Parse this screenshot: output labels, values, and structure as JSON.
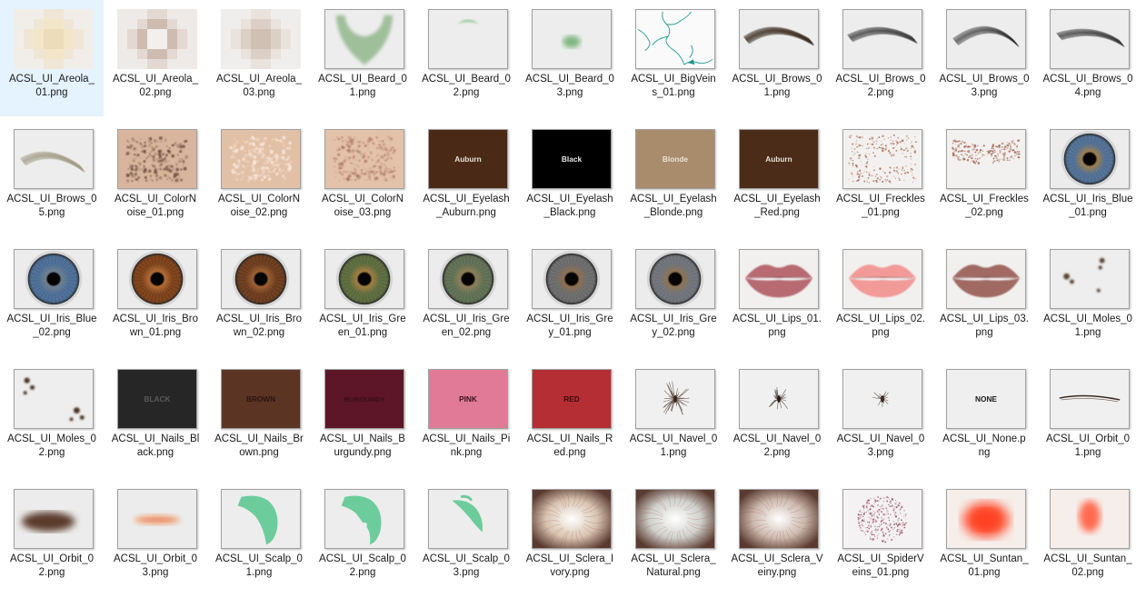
{
  "items": [
    {
      "name_lines": [
        "ACSL_UI_Areola_",
        "01.png"
      ],
      "icon": "pixelated-light-areola",
      "frame": false
    },
    {
      "name_lines": [
        "ACSL_UI_Areola_",
        "02.png"
      ],
      "icon": "pixelated-medium-areola",
      "frame": false
    },
    {
      "name_lines": [
        "ACSL_UI_Areola_",
        "03.png"
      ],
      "icon": "pixelated-faint-areola",
      "frame": false
    },
    {
      "name_lines": [
        "ACSL_UI_Beard_0",
        "1.png"
      ],
      "icon": "full-beard-mask"
    },
    {
      "name_lines": [
        "ACSL_UI_Beard_0",
        "2.png"
      ],
      "icon": "mustache-mask"
    },
    {
      "name_lines": [
        "ACSL_UI_Beard_0",
        "3.png"
      ],
      "icon": "goatee-mask"
    },
    {
      "name_lines": [
        "ACSL_UI_BigVein",
        "s_01.png"
      ],
      "icon": "vein-lines"
    },
    {
      "name_lines": [
        "ACSL_UI_Brows_0",
        "1.png"
      ],
      "icon": "eyebrow-thick"
    },
    {
      "name_lines": [
        "ACSL_UI_Brows_0",
        "2.png"
      ],
      "icon": "eyebrow-arched"
    },
    {
      "name_lines": [
        "ACSL_UI_Brows_0",
        "3.png"
      ],
      "icon": "eyebrow-high-arch"
    },
    {
      "name_lines": [
        "ACSL_UI_Brows_0",
        "4.png"
      ],
      "icon": "eyebrow-angled"
    },
    {
      "name_lines": [
        "ACSL_UI_Brows_0",
        "5.png"
      ],
      "icon": "eyebrow-light"
    },
    {
      "name_lines": [
        "ACSL_UI_ColorN",
        "oise_01.png"
      ],
      "icon": "skin-noise-dark"
    },
    {
      "name_lines": [
        "ACSL_UI_ColorN",
        "oise_02.png"
      ],
      "icon": "skin-noise-light"
    },
    {
      "name_lines": [
        "ACSL_UI_ColorN",
        "oise_03.png"
      ],
      "icon": "skin-noise-medium"
    },
    {
      "name_lines": [
        "ACSL_UI_Eyelash",
        "_Auburn.png"
      ],
      "icon": "swatch",
      "swatch_text": "Auburn",
      "swatch_color": "#4a2a16",
      "text_color": "#e8e0d8"
    },
    {
      "name_lines": [
        "ACSL_UI_Eyelash",
        "_Black.png"
      ],
      "icon": "swatch",
      "swatch_text": "Black",
      "swatch_color": "#000000",
      "text_color": "#e8e8e8"
    },
    {
      "name_lines": [
        "ACSL_UI_Eyelash",
        "_Blonde.png"
      ],
      "icon": "swatch",
      "swatch_text": "Blonde",
      "swatch_color": "#a88c6c",
      "text_color": "#ede3d6"
    },
    {
      "name_lines": [
        "ACSL_UI_Eyelash",
        "_Red.png"
      ],
      "icon": "swatch",
      "swatch_text": "Auburn",
      "swatch_color": "#4a2c18",
      "text_color": "#e8e0d8"
    },
    {
      "name_lines": [
        "ACSL_UI_Freckles",
        "_01.png"
      ],
      "icon": "freckles-full"
    },
    {
      "name_lines": [
        "ACSL_UI_Freckles",
        "_02.png"
      ],
      "icon": "freckles-band"
    },
    {
      "name_lines": [
        "ACSL_UI_Iris_Blue",
        "_01.png"
      ],
      "icon": "iris",
      "iris_color": "#4f6e92",
      "iris_inner": "#9a7a4a"
    },
    {
      "name_lines": [
        "ACSL_UI_Iris_Blue",
        "_02.png"
      ],
      "icon": "iris",
      "iris_color": "#4a6c94",
      "iris_inner": "#6b7a8a"
    },
    {
      "name_lines": [
        "ACSL_UI_Iris_Bro",
        "wn_01.png"
      ],
      "icon": "iris",
      "iris_color": "#7a3f18",
      "iris_inner": "#b0662e"
    },
    {
      "name_lines": [
        "ACSL_UI_Iris_Bro",
        "wn_02.png"
      ],
      "icon": "iris",
      "iris_color": "#6a3a1c",
      "iris_inner": "#9a5a2c"
    },
    {
      "name_lines": [
        "ACSL_UI_Iris_Gre",
        "en_01.png"
      ],
      "icon": "iris",
      "iris_color": "#5a6a3c",
      "iris_inner": "#a07a3a"
    },
    {
      "name_lines": [
        "ACSL_UI_Iris_Gre",
        "en_02.png"
      ],
      "icon": "iris",
      "iris_color": "#5e6e52",
      "iris_inner": "#8a7a52"
    },
    {
      "name_lines": [
        "ACSL_UI_Iris_Gre",
        "y_01.png"
      ],
      "icon": "iris",
      "iris_color": "#6a6a6a",
      "iris_inner": "#8a6a4a"
    },
    {
      "name_lines": [
        "ACSL_UI_Iris_Gre",
        "y_02.png"
      ],
      "icon": "iris",
      "iris_color": "#6e7278",
      "iris_inner": "#8a6e4e"
    },
    {
      "name_lines": [
        "ACSL_UI_Lips_01.",
        "png"
      ],
      "icon": "lips",
      "lip_color": "#b86a72"
    },
    {
      "name_lines": [
        "ACSL_UI_Lips_02.",
        "png"
      ],
      "icon": "lips",
      "lip_color": "#f29a98"
    },
    {
      "name_lines": [
        "ACSL_UI_Lips_03.",
        "png"
      ],
      "icon": "lips",
      "lip_color": "#a06a64"
    },
    {
      "name_lines": [
        "ACSL_UI_Moles_0",
        "1.png"
      ],
      "icon": "moles-scattered"
    },
    {
      "name_lines": [
        "ACSL_UI_Moles_0",
        "2.png"
      ],
      "icon": "moles-corners"
    },
    {
      "name_lines": [
        "ACSL_UI_Nails_Bl",
        "ack.png"
      ],
      "icon": "swatch",
      "swatch_text": "BLACK",
      "swatch_color": "#262626",
      "text_color": "#5a5a5a"
    },
    {
      "name_lines": [
        "ACSL_UI_Nails_Br",
        "own.png"
      ],
      "icon": "swatch",
      "swatch_text": "BROWN",
      "swatch_color": "#5c3424",
      "text_color": "#2a1410"
    },
    {
      "name_lines": [
        "ACSL_UI_Nails_B",
        "urgundy.png"
      ],
      "icon": "swatch",
      "swatch_text": "BURGUNDY",
      "swatch_color": "#5c1628",
      "text_color": "#3a0c18"
    },
    {
      "name_lines": [
        "ACSL_UI_Nails_Pi",
        "nk.png"
      ],
      "icon": "swatch",
      "swatch_text": "PINK",
      "swatch_color": "#e07a96",
      "text_color": "#3a1420"
    },
    {
      "name_lines": [
        "ACSL_UI_Nails_R",
        "ed.png"
      ],
      "icon": "swatch",
      "swatch_text": "RED",
      "swatch_color": "#b42e34",
      "text_color": "#3a0c0e"
    },
    {
      "name_lines": [
        "ACSL_UI_Navel_0",
        "1.png"
      ],
      "icon": "navel-hairy"
    },
    {
      "name_lines": [
        "ACSL_UI_Navel_0",
        "2.png"
      ],
      "icon": "navel-swirl"
    },
    {
      "name_lines": [
        "ACSL_UI_Navel_0",
        "3.png"
      ],
      "icon": "navel-small"
    },
    {
      "name_lines": [
        "ACSL_UI_None.p",
        "ng"
      ],
      "icon": "swatch",
      "swatch_text": "NONE",
      "swatch_color": "#efefef",
      "text_color": "#1a1a1a"
    },
    {
      "name_lines": [
        "ACSL_UI_Orbit_0",
        "1.png"
      ],
      "icon": "orbit-line"
    },
    {
      "name_lines": [
        "ACSL_UI_Orbit_0",
        "2.png"
      ],
      "icon": "orbit-dark-shadow"
    },
    {
      "name_lines": [
        "ACSL_UI_Orbit_0",
        "3.png"
      ],
      "icon": "orbit-light-shadow"
    },
    {
      "name_lines": [
        "ACSL_UI_Scalp_0",
        "1.png"
      ],
      "icon": "scalp-mask-full"
    },
    {
      "name_lines": [
        "ACSL_UI_Scalp_0",
        "2.png"
      ],
      "icon": "scalp-mask-partial"
    },
    {
      "name_lines": [
        "ACSL_UI_Scalp_0",
        "3.png"
      ],
      "icon": "scalp-mask-thin"
    },
    {
      "name_lines": [
        "ACSL_UI_Sclera_I",
        "vory.png"
      ],
      "icon": "sclera",
      "sclera_color": "#d8c4b0"
    },
    {
      "name_lines": [
        "ACSL_UI_Sclera_",
        "Natural.png"
      ],
      "icon": "sclera",
      "sclera_color": "#cfd0cc"
    },
    {
      "name_lines": [
        "ACSL_UI_Sclera_V",
        "einy.png"
      ],
      "icon": "sclera",
      "sclera_color": "#cdbab0"
    },
    {
      "name_lines": [
        "ACSL_UI_SpiderV",
        "eins_01.png"
      ],
      "icon": "spider-veins"
    },
    {
      "name_lines": [
        "ACSL_UI_Suntan_",
        "01.png"
      ],
      "icon": "suntan-wide"
    },
    {
      "name_lines": [
        "ACSL_UI_Suntan_",
        "02.png"
      ],
      "icon": "suntan-narrow"
    }
  ]
}
